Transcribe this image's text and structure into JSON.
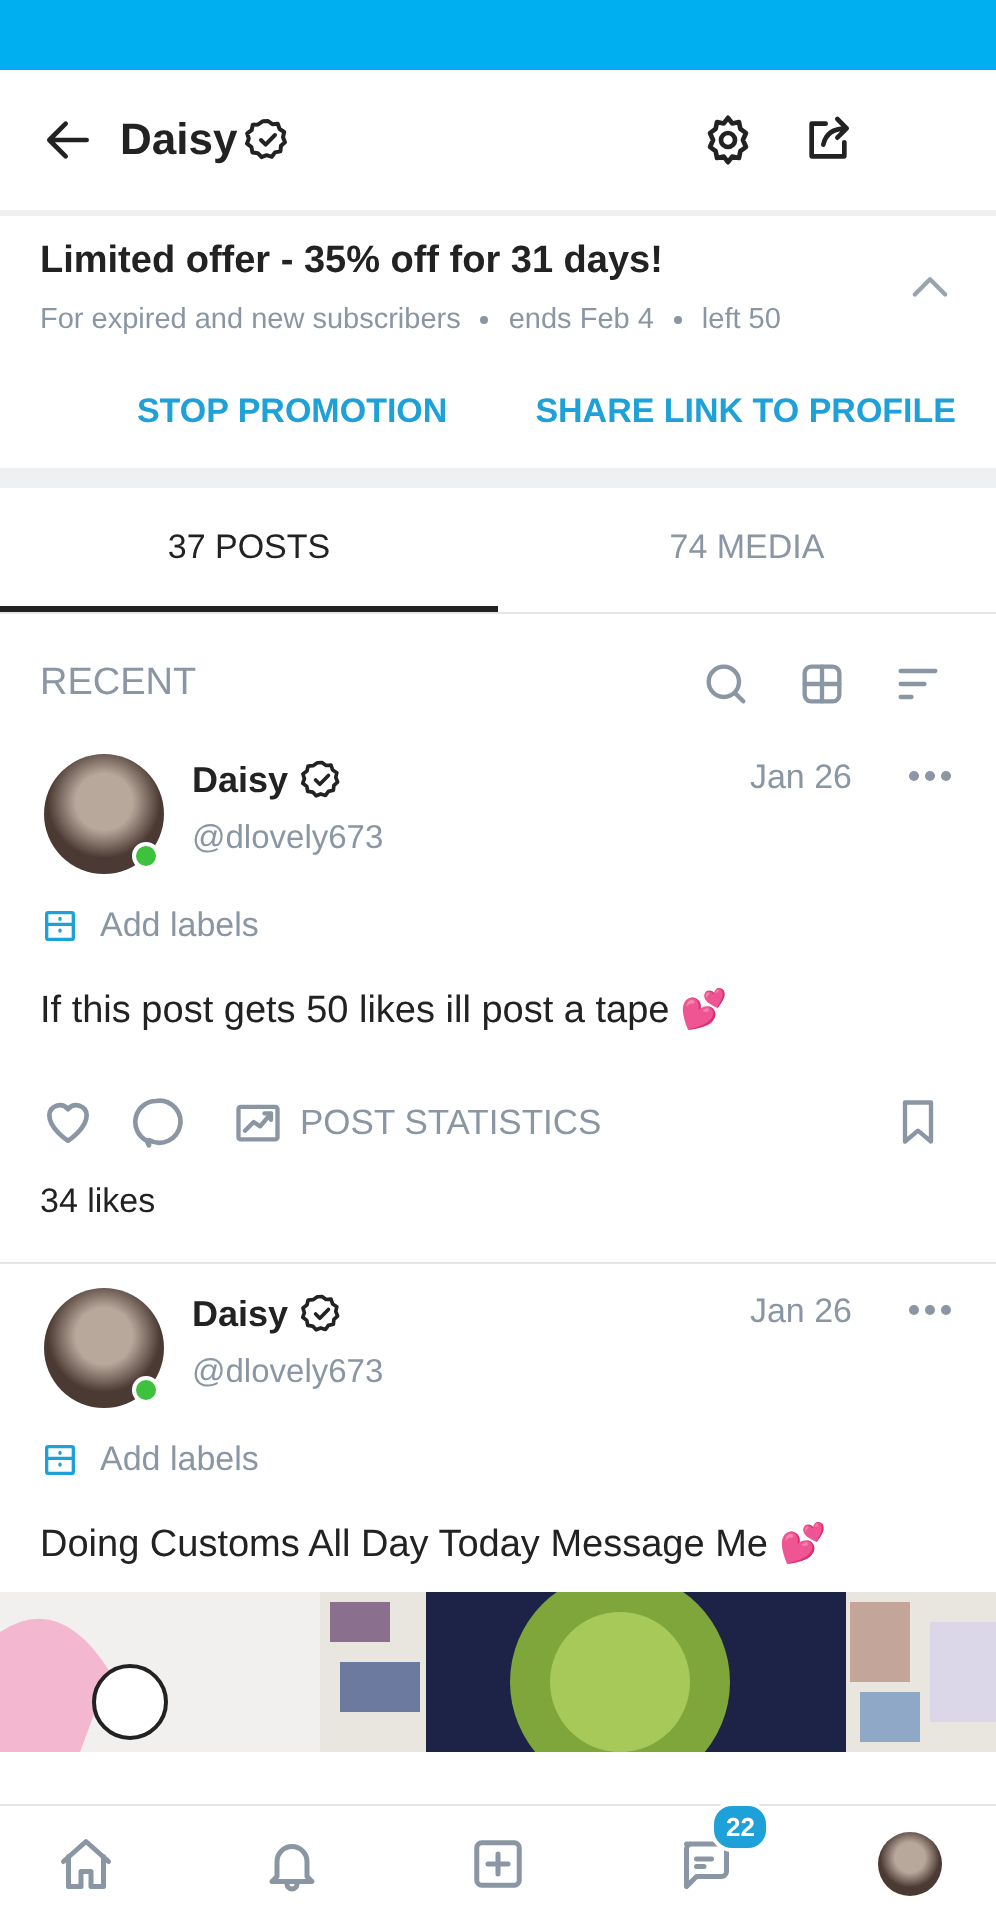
{
  "header": {
    "title": "Daisy",
    "verified": true
  },
  "promo": {
    "title": "Limited offer - 35% off for 31 days!",
    "details": [
      "For expired and new subscribers",
      "ends Feb 4",
      "left 50"
    ],
    "expanded": true,
    "actions": [
      "STOP PROMOTION",
      "SHARE LINK TO PROFILE"
    ]
  },
  "tabs": [
    {
      "label": "37 POSTS",
      "selected": true
    },
    {
      "label": "74 MEDIA",
      "selected": false
    }
  ],
  "section": {
    "title": "RECENT"
  },
  "posts": [
    {
      "author": "Daisy",
      "verified": true,
      "handle": "@dlovely673",
      "online": true,
      "date": "Jan 26",
      "labels_action": "Add labels",
      "text": "If this post gets 50 likes ill post a tape 💕",
      "stats_action": "POST STATISTICS",
      "likes": "34 likes"
    },
    {
      "author": "Daisy",
      "verified": true,
      "handle": "@dlovely673",
      "online": true,
      "date": "Jan 26",
      "labels_action": "Add labels",
      "text": "Doing Customs All Day Today Message Me 💕"
    }
  ],
  "nav": [
    {
      "kind": "home"
    },
    {
      "kind": "bell"
    },
    {
      "kind": "add"
    },
    {
      "kind": "messages",
      "badge": "22"
    },
    {
      "kind": "avatar"
    }
  ]
}
